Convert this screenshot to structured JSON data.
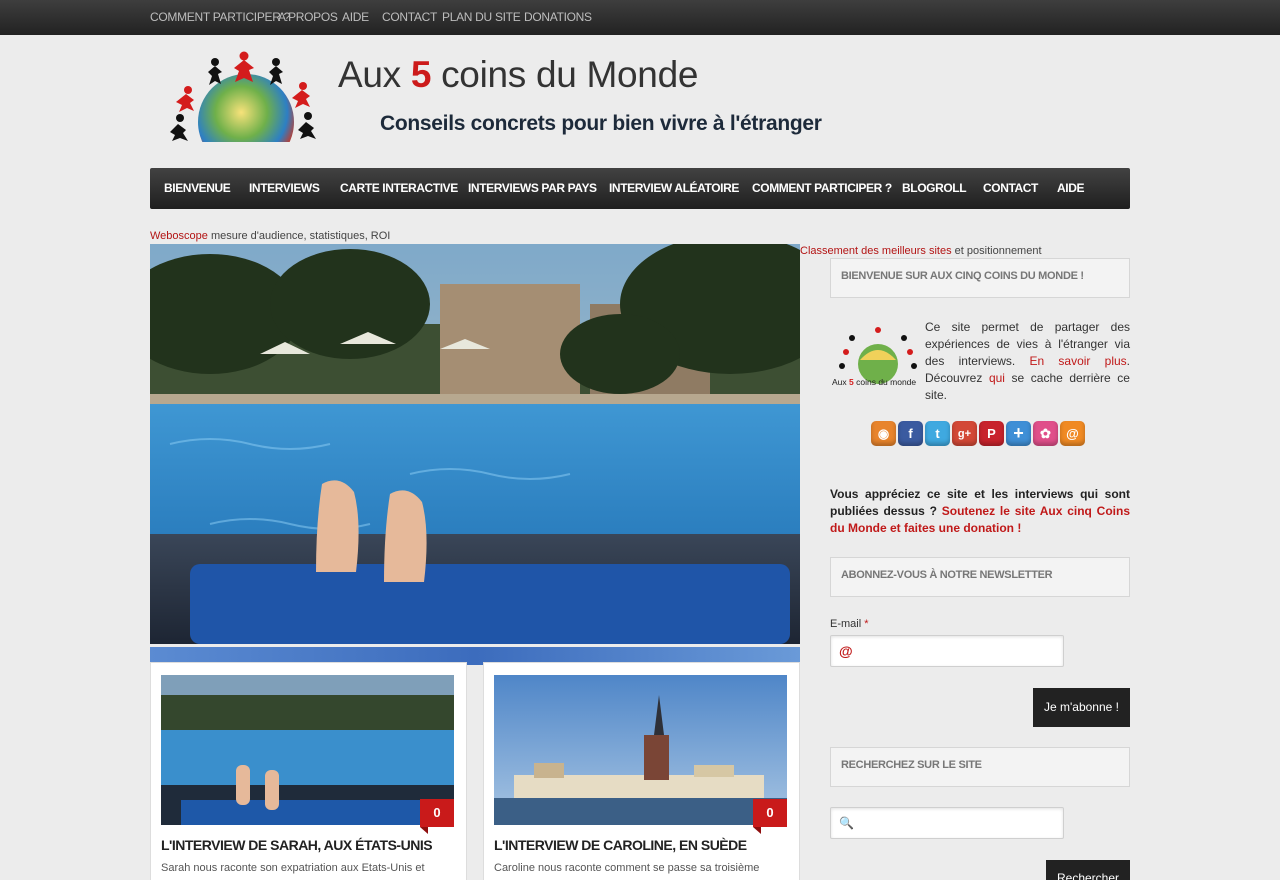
{
  "topbar": {
    "links": [
      "Comment participer ?",
      "A propos",
      "Aide",
      "Contact",
      "Plan du site",
      "Donations"
    ]
  },
  "header": {
    "title_prefix": "Aux ",
    "title_number": "5",
    "title_suffix": " coins du Monde",
    "tagline": "Conseils concrets pour bien vivre à l'étranger"
  },
  "mainnav": {
    "items": [
      "Bienvenue",
      "Interviews",
      "Carte interactive",
      "Interviews par pays",
      "Interview aléatoire",
      "Comment participer ?",
      "Blogroll",
      "Contact",
      "Aide"
    ]
  },
  "ads": {
    "left_link": "Weboscope",
    "left_text": " mesure d'audience, statistiques, ROI",
    "right_link": "Classement des meilleurs sites",
    "right_text": " et positionnement"
  },
  "posts": [
    {
      "title": "L'interview de Sarah, aux États-Unis",
      "excerpt": "Sarah nous raconte son expatriation aux Etats-Unis et",
      "comments": "0"
    },
    {
      "title": "L'interview de Caroline, en Suède",
      "excerpt": "Caroline nous raconte comment se passe sa troisième",
      "comments": "0"
    }
  ],
  "sidebar": {
    "welcome_title": "Bienvenue sur Aux cinq coins du monde !",
    "intro_logo_caption_a": "Aux ",
    "intro_logo_caption_5": "5",
    "intro_logo_caption_b": " coins du monde",
    "intro_text": "Ce site permet de partager des expériences de vies à l'étranger via des interviews. ",
    "intro_link": "En savoir plus",
    "intro_text2": ". Découvrez ",
    "intro_link2": "qui",
    "intro_text3": " se cache derrière ce site.",
    "social_icons": [
      {
        "name": "rss-icon",
        "glyph": "◉",
        "color": "#e8842c"
      },
      {
        "name": "facebook-icon",
        "glyph": "f",
        "color": "#3b5ba0"
      },
      {
        "name": "twitter-icon",
        "glyph": "t",
        "color": "#3fa9e0"
      },
      {
        "name": "google-plus-icon",
        "glyph": "g+",
        "color": "#d34836"
      },
      {
        "name": "pinterest-icon",
        "glyph": "P",
        "color": "#c8232c"
      },
      {
        "name": "addthis-icon",
        "glyph": "+",
        "color": "#3f8fd6"
      },
      {
        "name": "netvibes-icon",
        "glyph": "✿",
        "color": "#e04f8a"
      },
      {
        "name": "email-icon",
        "glyph": "@",
        "color": "#f08a24"
      }
    ],
    "donate_text": "Vous appréciez ce site et les interviews qui sont publiées dessus ? ",
    "donate_link": "Soutenez le site Aux cinq Coins du Monde et faites une donation !",
    "newsletter_title": "Abonnez-vous à notre newsletter",
    "email_label": "E-mail",
    "email_required": "*",
    "email_icon": "@",
    "subscribe_button": "Je m'abonne !",
    "search_title": "Recherchez sur le site",
    "search_icon": "🔍",
    "search_button": "Rechercher"
  }
}
